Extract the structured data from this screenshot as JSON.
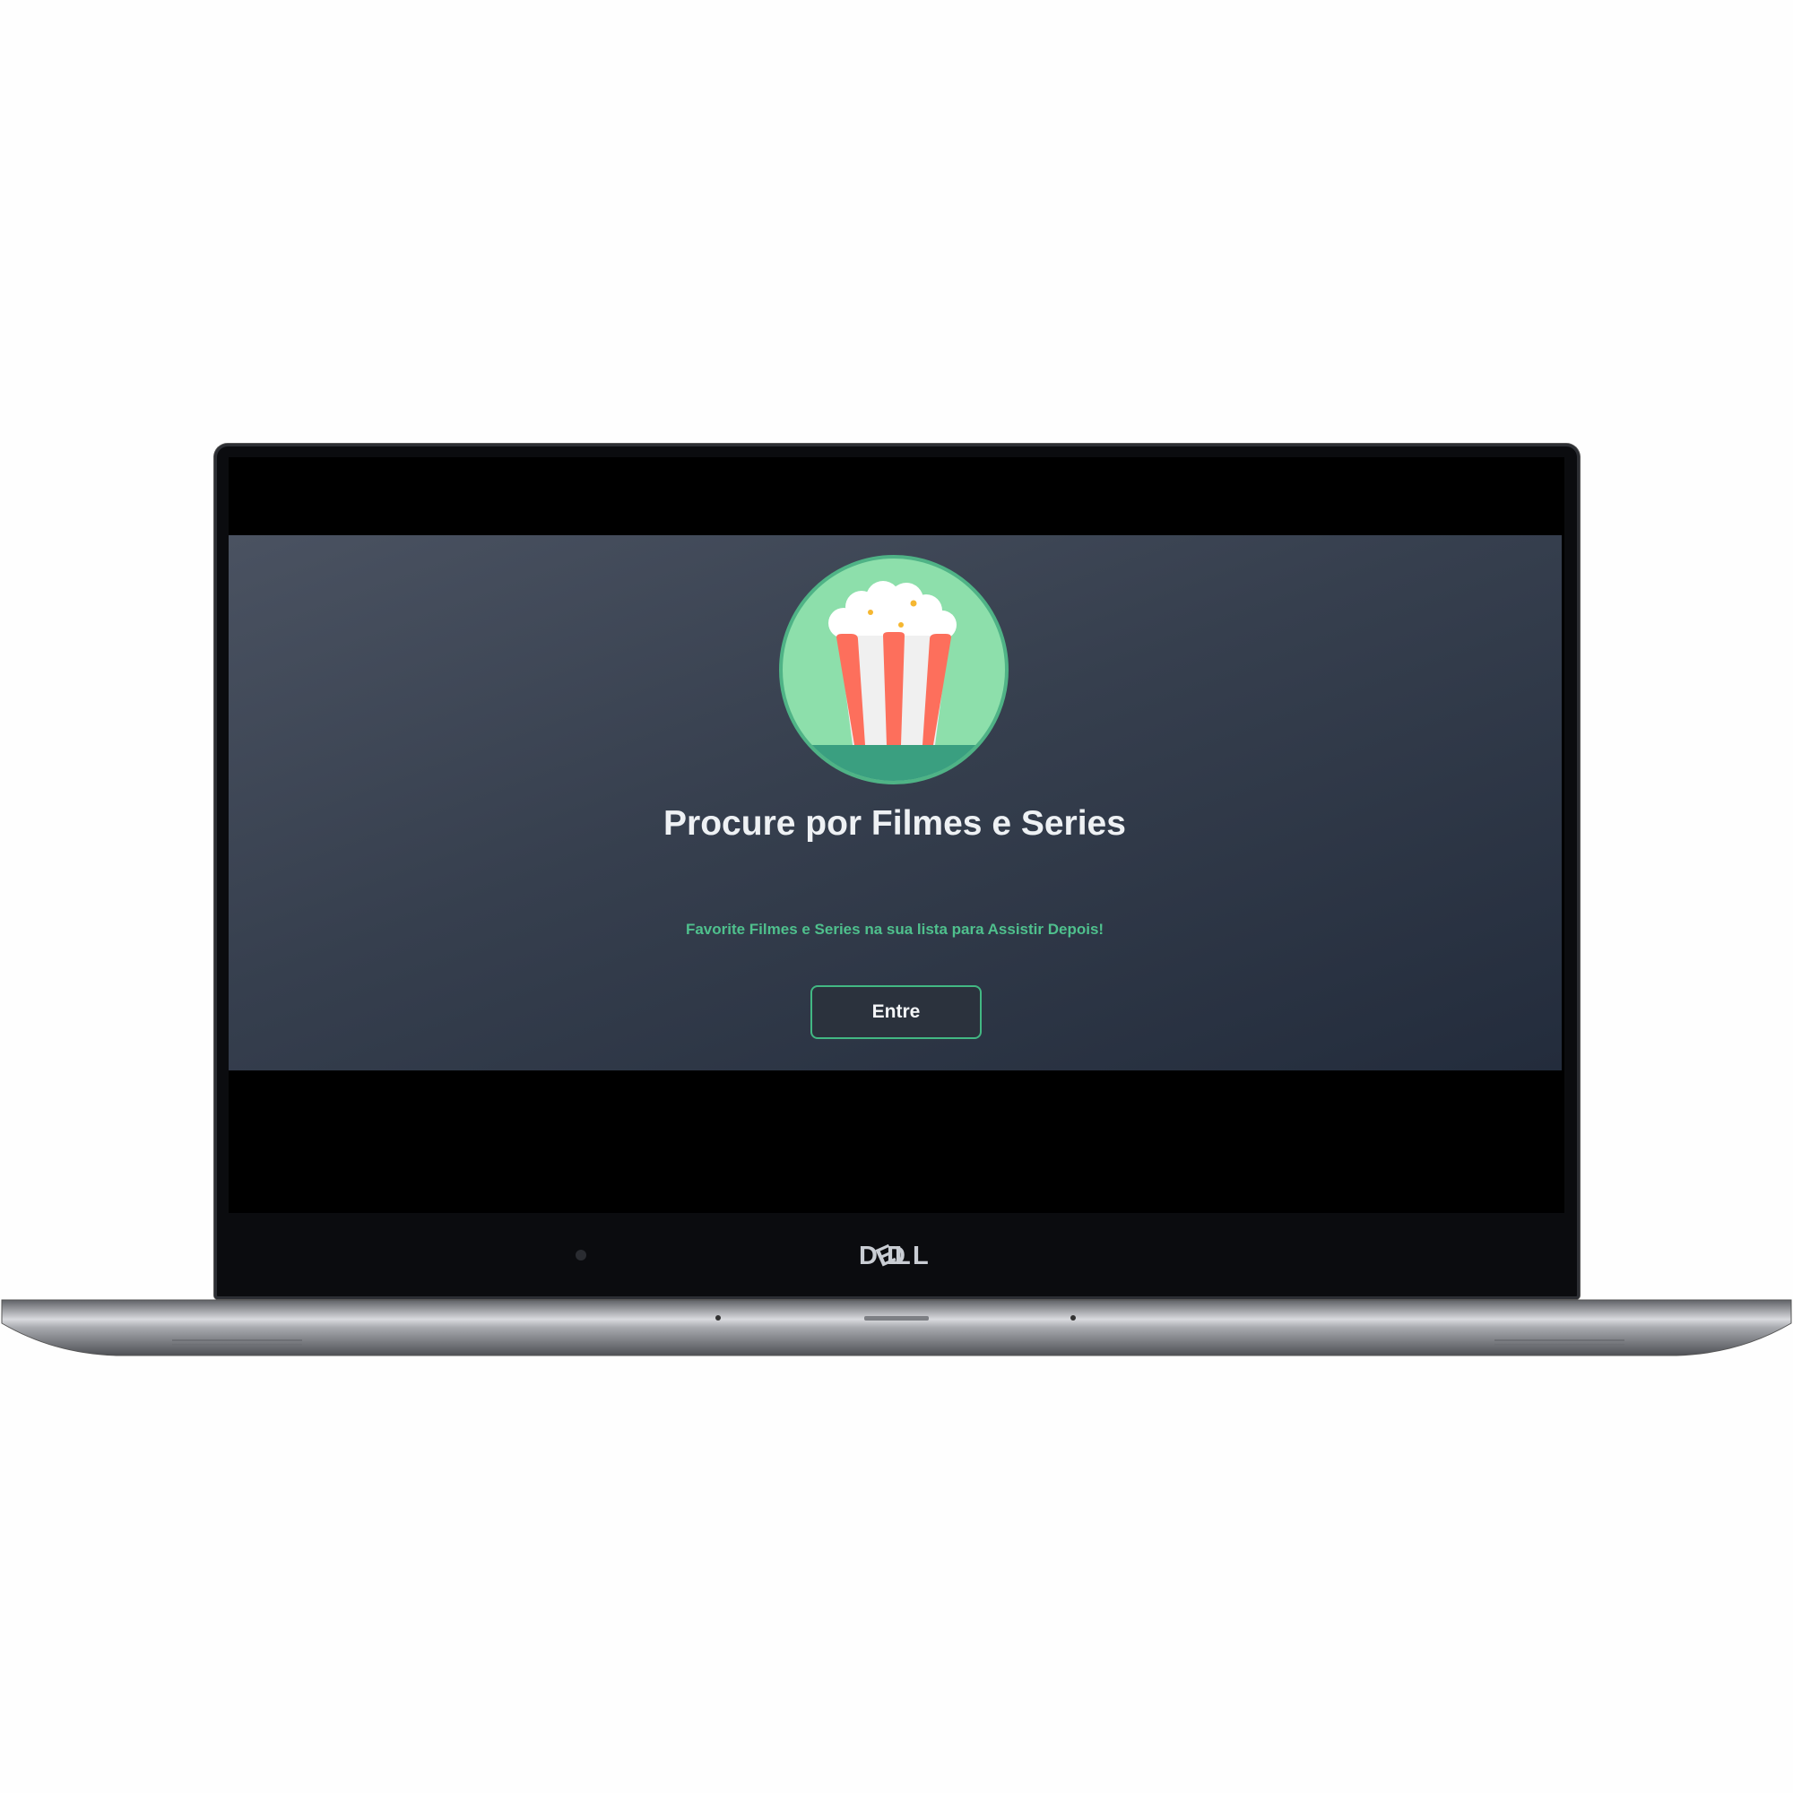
{
  "device": {
    "brand": "DELL"
  },
  "hero": {
    "title": "Procure por Filmes e Series",
    "subtitle": "Favorite Filmes e Series na sua lista para Assistir Depois!",
    "enter_label": "Entre"
  },
  "nav": {
    "items": [
      {
        "id": "home",
        "icon": "home-icon",
        "active": true
      },
      {
        "id": "tv",
        "icon": "tv-play-icon",
        "active": false
      },
      {
        "id": "search",
        "icon": "search-icon",
        "active": false
      },
      {
        "id": "favorites",
        "icon": "heart-icon",
        "active": false
      },
      {
        "id": "profile",
        "icon": "user-icon",
        "active": false
      }
    ]
  },
  "colors": {
    "accent": "#42b883",
    "search_button": "#1ab157",
    "nav_background": "#202835"
  }
}
